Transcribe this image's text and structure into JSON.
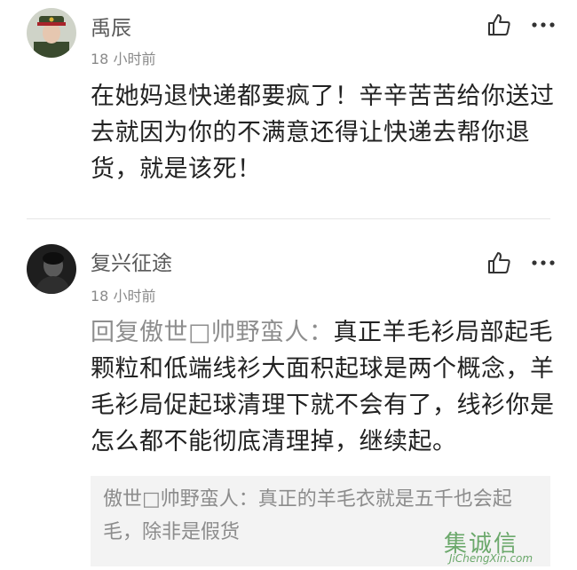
{
  "comments": [
    {
      "username": "禹辰",
      "time": "18 小时前",
      "reply_prefix": "",
      "text": "在她妈退快递都要疯了！辛辛苦苦给你送过去就因为你的不满意还得让快递去帮你退货，就是该死！",
      "avatar_icon": "avatar-soldier-uniform"
    },
    {
      "username": "复兴征途",
      "time": "18 小时前",
      "reply_prefix": "回复傲世□帅野蛮人：",
      "text": "真正羊毛衫局部起毛颗粒和低端线衫大面积起球是两个概念，羊毛衫局促起球清理下就不会有了，线衫你是怎么都不能彻底清理掉，继续起。",
      "quote": "傲世□帅野蛮人：真正的羊毛衣就是五千也会起毛，除非是假货",
      "avatar_icon": "avatar-dark-portrait"
    }
  ],
  "icons": {
    "like": "thumbs-up-icon",
    "more": "more-dots-icon"
  },
  "watermark": {
    "text": "集诚信",
    "sub": "JiChengXin.com"
  },
  "colors": {
    "username": "#5a5a5a",
    "time": "#8a8a8a",
    "body": "#222222",
    "reply_prefix": "#8e8e8e",
    "quote_bg": "#f3f3f3",
    "watermark": "#3e8f3e"
  }
}
